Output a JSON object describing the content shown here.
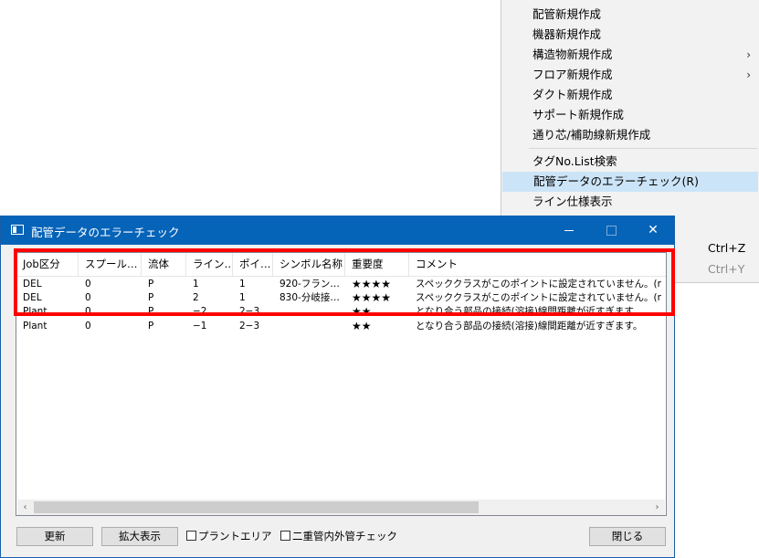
{
  "context_menu": {
    "items": [
      {
        "label": "配管新規作成"
      },
      {
        "label": "機器新規作成"
      },
      {
        "label": "構造物新規作成",
        "arrow": "›"
      },
      {
        "label": "フロア新規作成",
        "arrow": "›"
      },
      {
        "label": "ダクト新規作成"
      },
      {
        "label": "サポート新規作成"
      },
      {
        "label": "通り芯/補助線新規作成"
      },
      {
        "label": "タグNo.List検索"
      },
      {
        "label": "配管データのエラーチェック(R)"
      },
      {
        "label": "ライン仕様表示"
      },
      {
        "label": "",
        "shortcut": "Ctrl+Z"
      },
      {
        "label": "",
        "shortcut": "Ctrl+Y"
      }
    ]
  },
  "dialog": {
    "title": "配管データのエラーチェック",
    "close_glyph": "✕",
    "columns": [
      "Job区分",
      "スプール…",
      "流体",
      "ライン…",
      "ポイ…",
      "シンボル名称",
      "重要度",
      "コメント"
    ],
    "rows": [
      [
        "DEL",
        "0",
        "P",
        "1",
        "1",
        "920-フラン…",
        "★★★★",
        "スペッククラスがこのポイントに設定されていません。(r"
      ],
      [
        "DEL",
        "0",
        "P",
        "2",
        "1",
        "830-分岐接…",
        "★★★★",
        "スペッククラスがこのポイントに設定されていません。(r"
      ],
      [
        "Plant",
        "0",
        "P",
        "−2",
        "2−3",
        "",
        "★★",
        "となり合う部品の接続(溶接)線間距離が近すぎます。"
      ],
      [
        "Plant",
        "0",
        "P",
        "−1",
        "2−3",
        "",
        "★★",
        "となり合う部品の接続(溶接)線間距離が近すぎます。"
      ]
    ],
    "scroll_left": "‹",
    "scroll_right": "›",
    "buttons": {
      "refresh": "更新",
      "zoom": "拡大表示",
      "plant_area": "プラントエリア",
      "double_pipe": "二重管内外管チェック",
      "close": "閉じる"
    }
  }
}
